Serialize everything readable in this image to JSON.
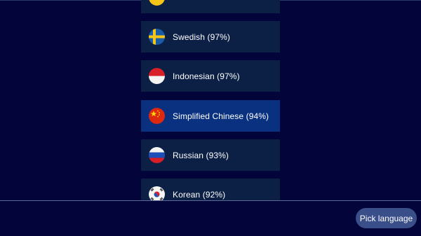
{
  "languages": [
    {
      "label": "",
      "flag": "yellow-flag-icon"
    },
    {
      "label": "Swedish (97%)",
      "flag": "sweden-flag-icon"
    },
    {
      "label": "Indonesian (97%)",
      "flag": "indonesia-flag-icon"
    },
    {
      "label": "Simplified Chinese (94%)",
      "flag": "china-flag-icon",
      "selected": true
    },
    {
      "label": "Russian (93%)",
      "flag": "russia-flag-icon"
    },
    {
      "label": "Korean (92%)",
      "flag": "south-korea-flag-icon"
    }
  ],
  "footer": {
    "pick_button_label": "Pick language"
  },
  "colors": {
    "background": "#03053a",
    "item_background": "#0c2046",
    "selected_item_background": "#0a3080",
    "button_background": "#3a4f8a"
  }
}
